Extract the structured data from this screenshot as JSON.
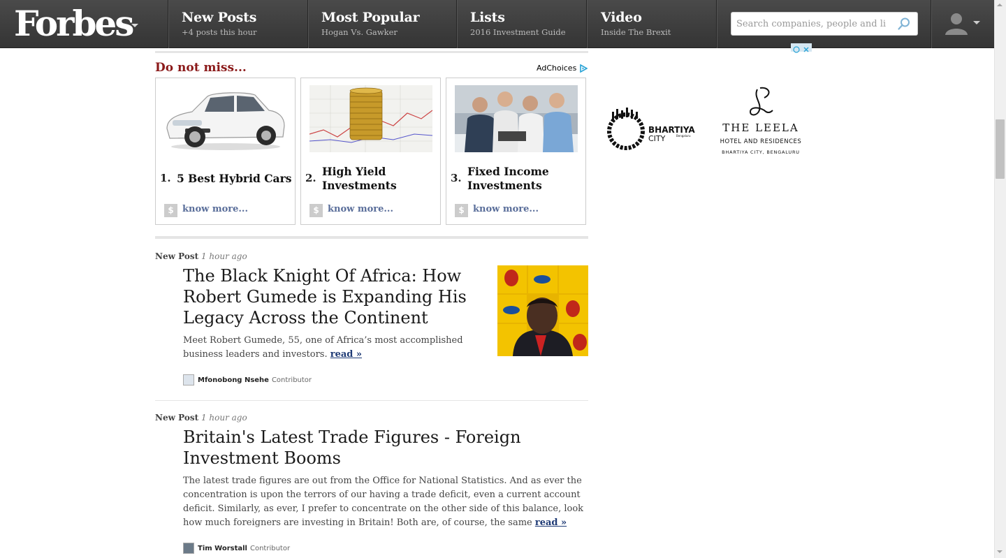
{
  "nav": {
    "logo": "Forbes",
    "items": [
      {
        "title": "New Posts",
        "sub": "+4 posts this hour"
      },
      {
        "title": "Most Popular",
        "sub": "Hogan Vs. Gawker"
      },
      {
        "title": "Lists",
        "sub": "2016 Investment Guide"
      },
      {
        "title": "Video",
        "sub": "Inside The Brexit"
      }
    ],
    "search_placeholder": "Search companies, people and lists"
  },
  "promo": {
    "heading": "Do not miss...",
    "adchoices": "AdChoices",
    "cards": [
      {
        "num": "1.",
        "label": "5 Best Hybrid Cars",
        "more": "know more...",
        "dollar": "$"
      },
      {
        "num": "2.",
        "label": "High Yield Investments",
        "more": "know more...",
        "dollar": "$"
      },
      {
        "num": "3.",
        "label": "Fixed Income Investments",
        "more": "know more...",
        "dollar": "$"
      }
    ]
  },
  "posts": [
    {
      "kind": "New Post",
      "age": "1 hour ago",
      "title": "The Black Knight Of Africa: How Robert Gumede is Expanding His Legacy Across the Continent",
      "excerpt": "Meet Robert Gumede, 55, one of Africa’s most accomplished business leaders and investors.",
      "read": "read »",
      "author": "Mfonobong Nsehe",
      "role": "Contributor"
    },
    {
      "kind": "New Post",
      "age": "1 hour ago",
      "title": "Britain's Latest Trade Figures - Foreign Investment Booms",
      "excerpt": "The latest trade figures are out from the Office for National Statistics. And as ever the concentration is upon the terrors of our having a trade deficit, even a current account deficit. Similarly, as ever, I prefer to concentrate on the other side of this balance, look how much foreigners are investing in Britain! Both are, of course, the same",
      "read": "read »",
      "author": "Tim Worstall",
      "role": "Contributor"
    }
  ],
  "sidebar_ad": {
    "brand1": "BHARTIYA",
    "brand1_sub": "CITY",
    "brand1_tag": "Bengaluru",
    "brand2": "THE LEELA",
    "brand2_sub": "HOTEL AND RESIDENCES",
    "brand2_loc": "BHARTIYA CITY, BENGALURU"
  },
  "colors": {
    "nav_bg": "#3d3d3d",
    "accent_red": "#8b1a1a",
    "link_blue": "#1e3a75",
    "know_more": "#5a6e9a"
  }
}
